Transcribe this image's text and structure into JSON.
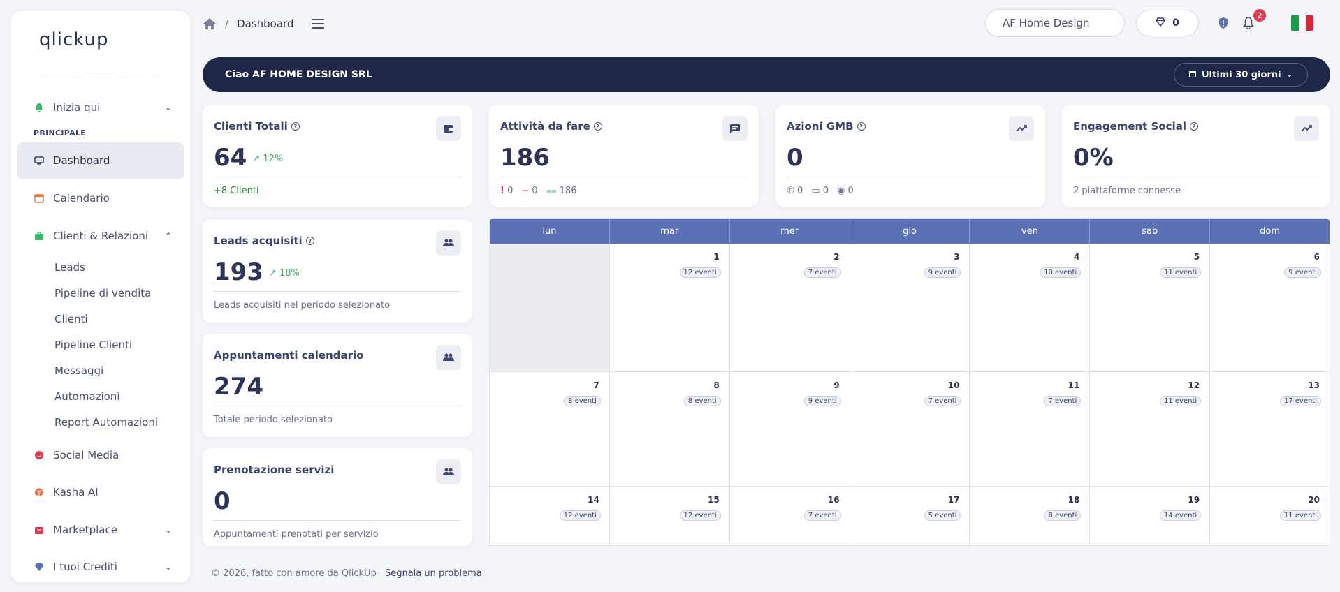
{
  "logo": {
    "text": "qlickup"
  },
  "sidebar": {
    "inizia": "Inizia qui",
    "section": "PRINCIPALE",
    "dashboard": "Dashboard",
    "calendario": "Calendario",
    "clienti_rel": "Clienti & Relazioni",
    "sub": [
      "Leads",
      "Pipeline di vendita",
      "Clienti",
      "Pipeline Clienti",
      "Messaggi",
      "Automazioni",
      "Report Automazioni"
    ],
    "social": "Social Media",
    "kasha": "Kasha AI",
    "marketplace": "Marketplace",
    "crediti": "I tuoi Crediti"
  },
  "topbar": {
    "breadcrumb": "Dashboard",
    "search_value": "AF Home Design",
    "credits": "0",
    "notifications": "2"
  },
  "banner": {
    "greeting": "Ciao AF HOME DESIGN SRL",
    "range": "Ultimi 30 giorni"
  },
  "cards": {
    "clienti": {
      "title": "Clienti Totali",
      "value": "64",
      "trend": "12%",
      "foot": "+8 Clienti"
    },
    "attivita": {
      "title": "Attività da fare",
      "value": "186",
      "f1": "0",
      "f2": "0",
      "f3": "186"
    },
    "gmb": {
      "title": "Azioni GMB",
      "value": "0",
      "f1": "0",
      "f2": "0",
      "f3": "0"
    },
    "social": {
      "title": "Engagement Social",
      "value": "0%",
      "foot": "2 piattaforme connesse"
    },
    "leads": {
      "title": "Leads acquisiti",
      "value": "193",
      "trend": "18%",
      "foot": "Leads acquisiti nel periodo selezionato"
    },
    "appuntamenti": {
      "title": "Appuntamenti calendario",
      "value": "274",
      "foot": "Totale periodo selezionato"
    },
    "prenotazioni": {
      "title": "Prenotazione servizi",
      "value": "0",
      "foot": "Appuntamenti prenotati per servizio"
    }
  },
  "calendar": {
    "days": [
      "lun",
      "mar",
      "mer",
      "gio",
      "ven",
      "sab",
      "dom"
    ],
    "weeks": [
      [
        null,
        {
          "d": "1",
          "e": "12 eventi"
        },
        {
          "d": "2",
          "e": "7 eventi"
        },
        {
          "d": "3",
          "e": "9 eventi"
        },
        {
          "d": "4",
          "e": "10 eventi"
        },
        {
          "d": "5",
          "e": "11 eventi"
        },
        {
          "d": "6",
          "e": "9 eventi"
        }
      ],
      [
        {
          "d": "7",
          "e": "8 eventi"
        },
        {
          "d": "8",
          "e": "8 eventi"
        },
        {
          "d": "9",
          "e": "9 eventi"
        },
        {
          "d": "10",
          "e": "7 eventi"
        },
        {
          "d": "11",
          "e": "7 eventi"
        },
        {
          "d": "12",
          "e": "11 eventi"
        },
        {
          "d": "13",
          "e": "17 eventi"
        }
      ],
      [
        {
          "d": "14",
          "e": "12 eventi"
        },
        {
          "d": "15",
          "e": "12 eventi"
        },
        {
          "d": "16",
          "e": "7 eventi"
        },
        {
          "d": "17",
          "e": "5 eventi"
        },
        {
          "d": "18",
          "e": "8 eventi"
        },
        {
          "d": "19",
          "e": "14 eventi"
        },
        {
          "d": "20",
          "e": "11 eventi"
        }
      ]
    ]
  },
  "footer": {
    "copy": "© 2026, fatto con amore da QlickUp",
    "report": "Segnala un problema"
  },
  "colors": {
    "accent": "#5b6fb5",
    "banner": "#1f2748",
    "positive": "#3eaa64"
  }
}
